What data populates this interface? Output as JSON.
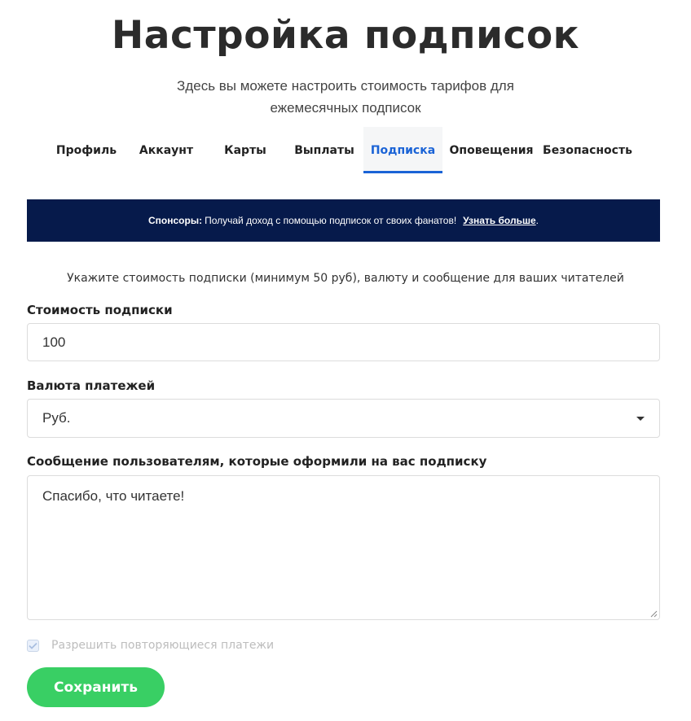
{
  "page": {
    "title": "Настройка подписок",
    "subtitle": "Здесь вы можете настроить стоимость тарифов для ежемесячных подписок"
  },
  "tabs": [
    {
      "label": "Профиль",
      "active": false
    },
    {
      "label": "Аккаунт",
      "active": false
    },
    {
      "label": "Карты",
      "active": false
    },
    {
      "label": "Выплаты",
      "active": false
    },
    {
      "label": "Подписка",
      "active": true
    },
    {
      "label": "Оповещения",
      "active": false
    },
    {
      "label": "Безопасность",
      "active": false
    }
  ],
  "banner": {
    "prefix": "Спонсоры:",
    "text": "Получай доход с помощью подписок от своих фанатов!",
    "link_label": "Узнать больше",
    "suffix": "."
  },
  "form": {
    "hint": "Укажите стоимость подписки (минимум 50 руб), валюту и сообщение для ваших читателей",
    "price": {
      "label": "Стоимость подписки",
      "value": "100"
    },
    "currency": {
      "label": "Валюта платежей",
      "selected": "Руб."
    },
    "message": {
      "label": "Сообщение пользователям, которые оформили на вас подписку",
      "value": "Спасибо, что читаете!"
    },
    "recurring": {
      "label": "Разрешить повторяющиеся платежи",
      "checked": true
    },
    "save_label": "Сохранить"
  },
  "colors": {
    "accent": "#1a63d6",
    "banner_bg": "#061a4b",
    "save_button": "#39cf64"
  },
  "icons": {
    "select_caret": "caret-down-icon",
    "checkbox_check": "check-icon",
    "textarea_resize": "resize-grip-icon"
  }
}
